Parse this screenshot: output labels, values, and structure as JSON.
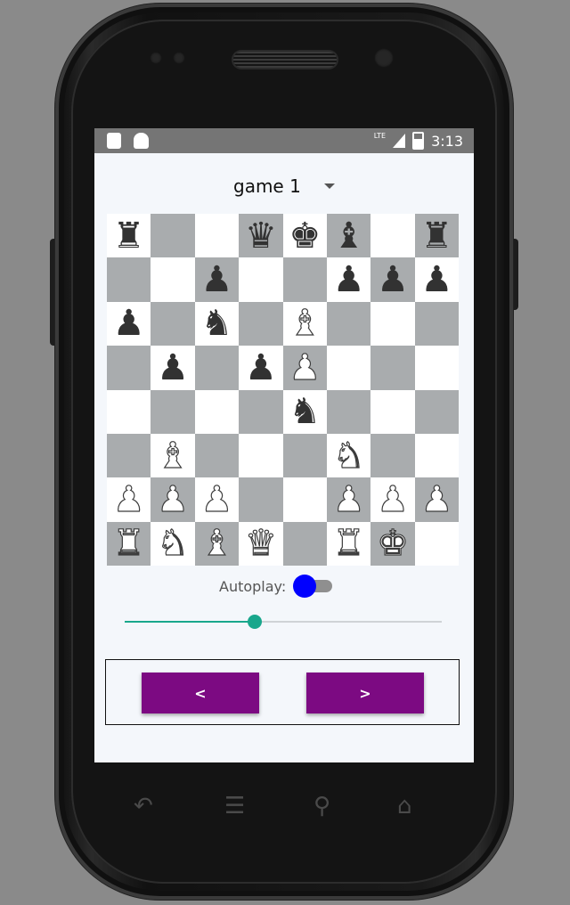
{
  "status_bar": {
    "network": "LTE",
    "time": "3:13",
    "left_icons": [
      "sd-card-icon",
      "android-icon"
    ]
  },
  "game_selector": {
    "selected": "game 1"
  },
  "board": {
    "ranks": [
      [
        "bR",
        "",
        "",
        "bQ",
        "bK",
        "bB",
        "",
        "bR"
      ],
      [
        "",
        "",
        "bP",
        "",
        "",
        "bP",
        "bP",
        "bP"
      ],
      [
        "bP",
        "",
        "bN",
        "",
        "wB",
        "",
        "",
        ""
      ],
      [
        "",
        "bP",
        "",
        "bP",
        "wP",
        "",
        "",
        ""
      ],
      [
        "",
        "",
        "",
        "",
        "bN",
        "",
        "",
        ""
      ],
      [
        "",
        "wB",
        "",
        "",
        "",
        "wN",
        "",
        ""
      ],
      [
        "wP",
        "wP",
        "wP",
        "",
        "",
        "wP",
        "wP",
        "wP"
      ],
      [
        "wR",
        "wN",
        "wB",
        "wQ",
        "",
        "wR",
        "wK",
        ""
      ]
    ],
    "colors": {
      "light": "#ffffff",
      "dark": "#a9acae"
    }
  },
  "autoplay": {
    "label": "Autoplay:",
    "enabled": false,
    "thumb_color": "#0000ff"
  },
  "slider": {
    "value": 0.41,
    "color": "#19a78c"
  },
  "nav": {
    "prev_label": "<",
    "next_label": ">",
    "button_color": "#7c0a82"
  },
  "softkeys": [
    "back-icon",
    "menu-icon",
    "search-icon",
    "home-icon"
  ]
}
